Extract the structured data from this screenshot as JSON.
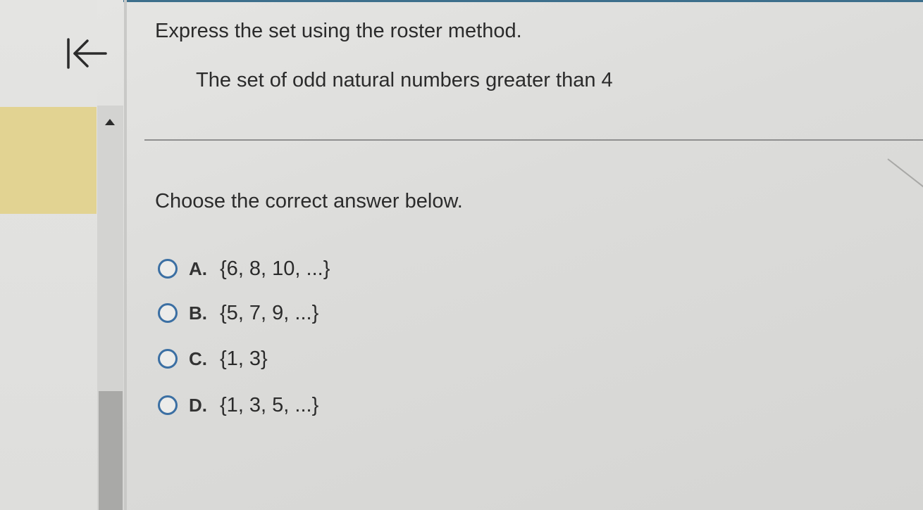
{
  "sidebar": {
    "collapse_icon": "collapse-left-arrow-icon",
    "scroll_up_icon": "triangle-up-icon"
  },
  "question": {
    "instruction": "Express the set using the roster method.",
    "text": "The set of odd natural numbers greater than 4",
    "prompt": "Choose the correct answer below."
  },
  "options": [
    {
      "letter": "A.",
      "text": "{6, 8, 10, ...}"
    },
    {
      "letter": "B.",
      "text": "{5, 7, 9, ...}"
    },
    {
      "letter": "C.",
      "text": "{1, 3}"
    },
    {
      "letter": "D.",
      "text": "{1, 3, 5, ...}"
    }
  ],
  "colors": {
    "radio_border": "#3b6fa3",
    "highlight": "#e2d392",
    "top_accent": "#3d6f8c"
  }
}
